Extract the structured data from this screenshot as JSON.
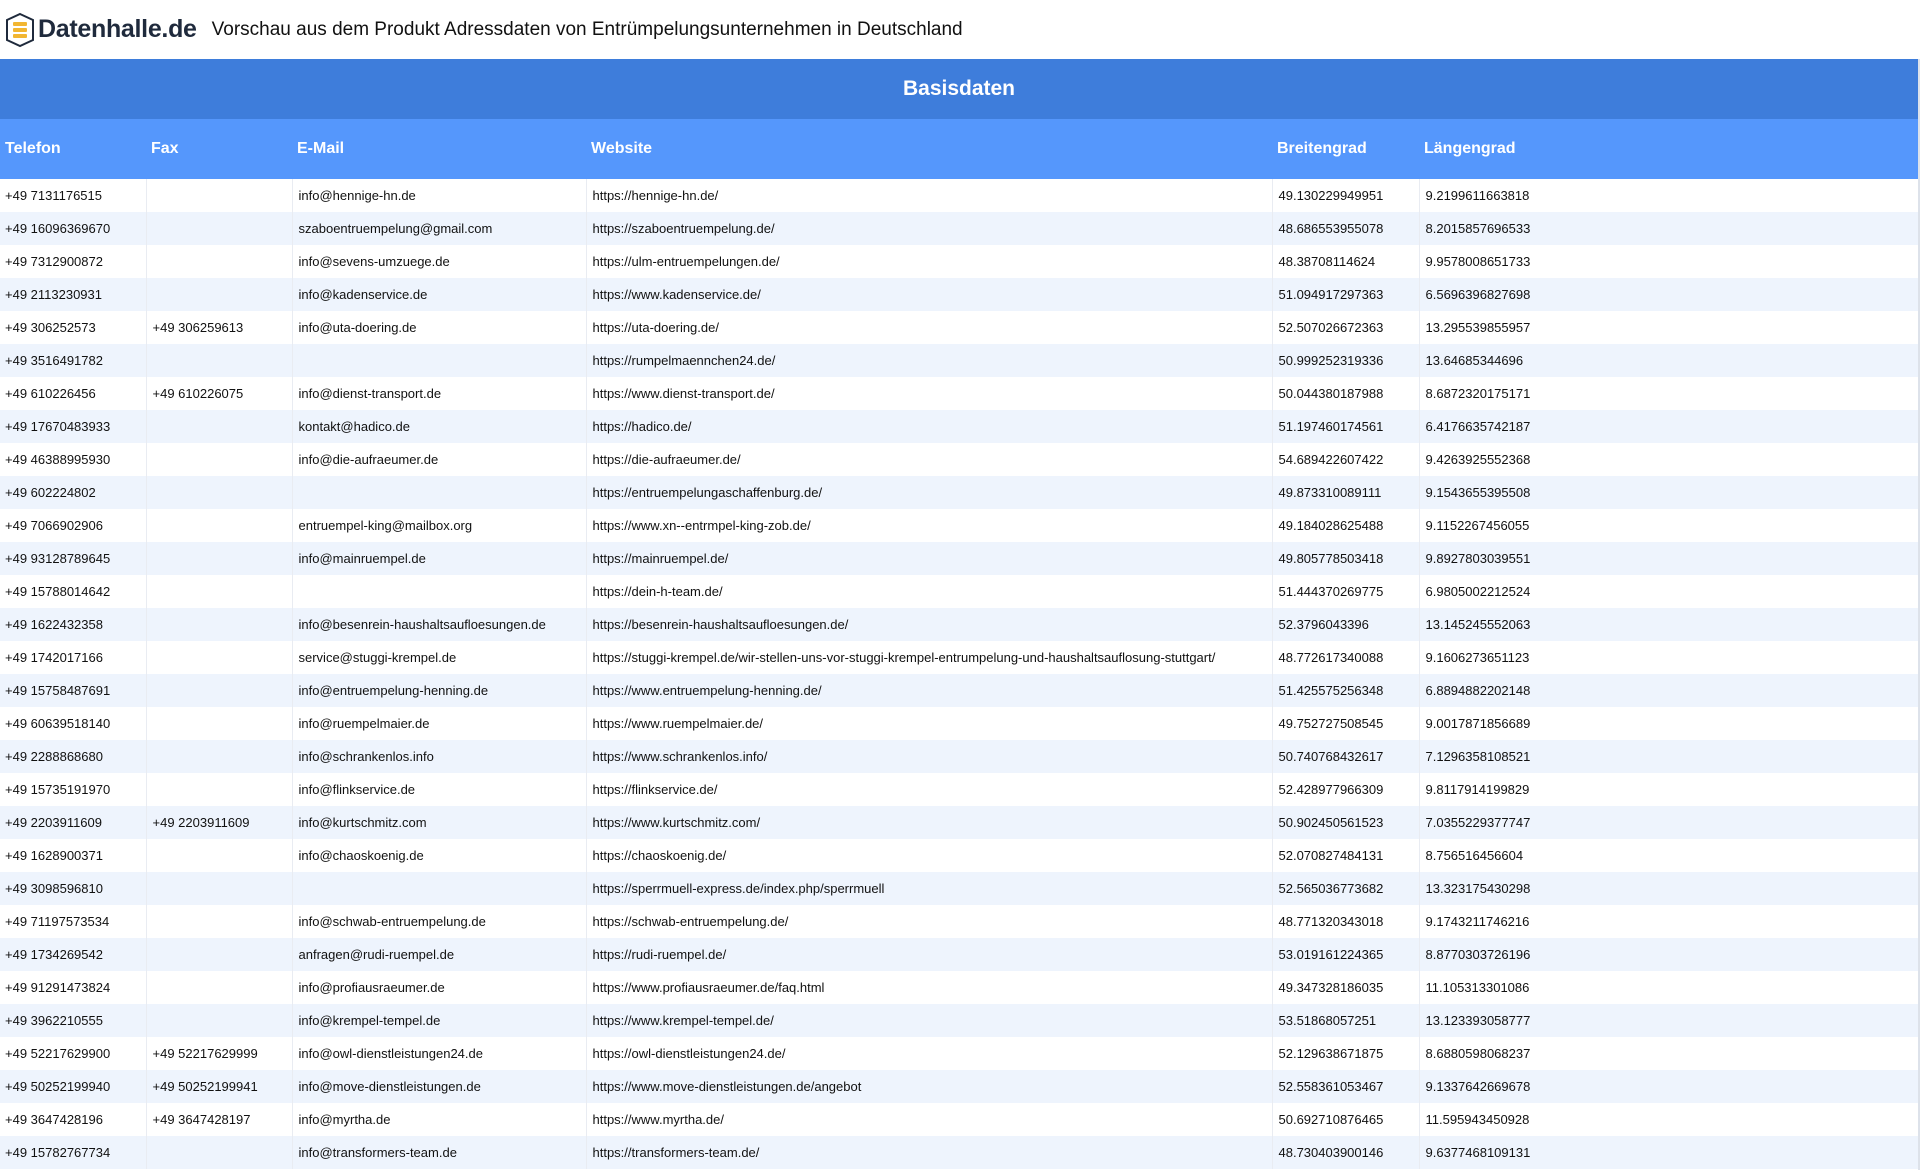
{
  "header": {
    "logo_text": "Datenhalle.de",
    "title": "Vorschau aus dem Produkt Adressdaten von Entrümpelungsunternehmen in Deutschland"
  },
  "section": {
    "title": "Basisdaten"
  },
  "colors": {
    "section_bar": "#3e7ddb",
    "table_header": "#5597fc",
    "row_stripe": "#eef4fd",
    "logo_accent": "#f2b632"
  },
  "table": {
    "columns": [
      "Telefon",
      "Fax",
      "E-Mail",
      "Website",
      "Breitengrad",
      "Längengrad"
    ],
    "rows": [
      [
        "+49 7131176515",
        "",
        "info@hennige-hn.de",
        "https://hennige-hn.de/",
        "49.130229949951",
        "9.2199611663818"
      ],
      [
        "+49 16096369670",
        "",
        "szaboentruempelung@gmail.com",
        "https://szaboentruempelung.de/",
        "48.686553955078",
        "8.2015857696533"
      ],
      [
        "+49 7312900872",
        "",
        "info@sevens-umzuege.de",
        "https://ulm-entruempelungen.de/",
        "48.38708114624",
        "9.9578008651733"
      ],
      [
        "+49 2113230931",
        "",
        "info@kadenservice.de",
        "https://www.kadenservice.de/",
        "51.094917297363",
        "6.5696396827698"
      ],
      [
        "+49 306252573",
        "+49 306259613",
        "info@uta-doering.de",
        "https://uta-doering.de/",
        "52.507026672363",
        "13.295539855957"
      ],
      [
        "+49 3516491782",
        "",
        "",
        "https://rumpelmaennchen24.de/",
        "50.999252319336",
        "13.64685344696"
      ],
      [
        "+49 610226456",
        "+49 610226075",
        "info@dienst-transport.de",
        "https://www.dienst-transport.de/",
        "50.044380187988",
        "8.6872320175171"
      ],
      [
        "+49 17670483933",
        "",
        "kontakt@hadico.de",
        "https://hadico.de/",
        "51.197460174561",
        "6.4176635742187"
      ],
      [
        "+49 46388995930",
        "",
        "info@die-aufraeumer.de",
        "https://die-aufraeumer.de/",
        "54.689422607422",
        "9.4263925552368"
      ],
      [
        "+49 602224802",
        "",
        "",
        "https://entruempelungaschaffenburg.de/",
        "49.873310089111",
        "9.1543655395508"
      ],
      [
        "+49 7066902906",
        "",
        "entruempel-king@mailbox.org",
        "https://www.xn--entrmpel-king-zob.de/",
        "49.184028625488",
        "9.1152267456055"
      ],
      [
        "+49 93128789645",
        "",
        "info@mainruempel.de",
        "https://mainruempel.de/",
        "49.805778503418",
        "9.8927803039551"
      ],
      [
        "+49 15788014642",
        "",
        "",
        "https://dein-h-team.de/",
        "51.444370269775",
        "6.9805002212524"
      ],
      [
        "+49 1622432358",
        "",
        "info@besenrein-haushaltsaufloesungen.de",
        "https://besenrein-haushaltsaufloesungen.de/",
        "52.3796043396",
        "13.145245552063"
      ],
      [
        "+49 1742017166",
        "",
        "service@stuggi-krempel.de",
        "https://stuggi-krempel.de/wir-stellen-uns-vor-stuggi-krempel-entrumpelung-und-haushaltsauflosung-stuttgart/",
        "48.772617340088",
        "9.1606273651123"
      ],
      [
        "+49 15758487691",
        "",
        "info@entruempelung-henning.de",
        "https://www.entruempelung-henning.de/",
        "51.425575256348",
        "6.8894882202148"
      ],
      [
        "+49 60639518140",
        "",
        "info@ruempelmaier.de",
        "https://www.ruempelmaier.de/",
        "49.752727508545",
        "9.0017871856689"
      ],
      [
        "+49 2288868680",
        "",
        "info@schrankenlos.info",
        "https://www.schrankenlos.info/",
        "50.740768432617",
        "7.1296358108521"
      ],
      [
        "+49 15735191970",
        "",
        "info@flinkservice.de",
        "https://flinkservice.de/",
        "52.428977966309",
        "9.8117914199829"
      ],
      [
        "+49 2203911609",
        "+49 2203911609",
        "info@kurtschmitz.com",
        "https://www.kurtschmitz.com/",
        "50.902450561523",
        "7.0355229377747"
      ],
      [
        "+49 1628900371",
        "",
        "info@chaoskoenig.de",
        "https://chaoskoenig.de/",
        "52.070827484131",
        "8.756516456604"
      ],
      [
        "+49 3098596810",
        "",
        "",
        "https://sperrmuell-express.de/index.php/sperrmuell",
        "52.565036773682",
        "13.323175430298"
      ],
      [
        "+49 71197573534",
        "",
        "info@schwab-entruempelung.de",
        "https://schwab-entruempelung.de/",
        "48.771320343018",
        "9.1743211746216"
      ],
      [
        "+49 1734269542",
        "",
        "anfragen@rudi-ruempel.de",
        "https://rudi-ruempel.de/",
        "53.019161224365",
        "8.8770303726196"
      ],
      [
        "+49 91291473824",
        "",
        "info@profiausraeumer.de",
        "https://www.profiausraeumer.de/faq.html",
        "49.347328186035",
        "11.105313301086"
      ],
      [
        "+49 3962210555",
        "",
        "info@krempel-tempel.de",
        "https://www.krempel-tempel.de/",
        "53.51868057251",
        "13.123393058777"
      ],
      [
        "+49 52217629900",
        "+49 52217629999",
        "info@owl-dienstleistungen24.de",
        "https://owl-dienstleistungen24.de/",
        "52.129638671875",
        "8.6880598068237"
      ],
      [
        "+49 50252199940",
        "+49 50252199941",
        "info@move-dienstleistungen.de",
        "https://www.move-dienstleistungen.de/angebot",
        "52.558361053467",
        "9.1337642669678"
      ],
      [
        "+49 3647428196",
        "+49 3647428197",
        "info@myrtha.de",
        "https://www.myrtha.de/",
        "50.692710876465",
        "11.595943450928"
      ],
      [
        "+49 15782767734",
        "",
        "info@transformers-team.de",
        "https://transformers-team.de/",
        "48.730403900146",
        "9.6377468109131"
      ]
    ]
  }
}
